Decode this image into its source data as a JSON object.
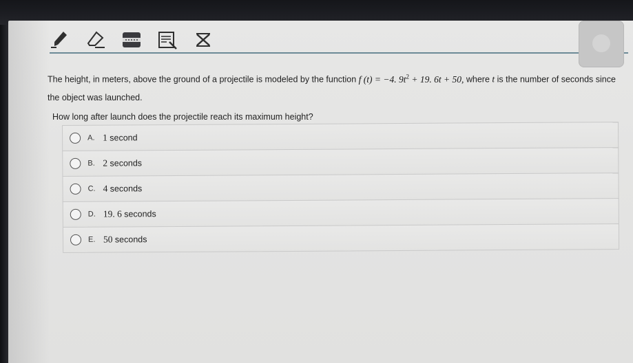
{
  "toolbar": {
    "tools": [
      {
        "name": "pencil-icon"
      },
      {
        "name": "eraser-icon"
      },
      {
        "name": "highlight-bar-icon"
      },
      {
        "name": "notes-icon"
      },
      {
        "name": "crossout-icon"
      }
    ]
  },
  "question": {
    "text_before": "The height, in meters, above the ground of a projectile is modeled by the function ",
    "function_lhs": "f (t) = −4. 9t",
    "exponent": "2",
    "function_rhs": " + 19. 6t + 50,",
    "text_where": " where ",
    "variable": "t",
    "text_after": " is the number of seconds since the object was launched."
  },
  "prompt": "How long after launch does the projectile reach its maximum height?",
  "options": [
    {
      "letter": "A.",
      "value": "1",
      "unit": "second"
    },
    {
      "letter": "B.",
      "value": "2",
      "unit": "seconds"
    },
    {
      "letter": "C.",
      "value": "4",
      "unit": "seconds"
    },
    {
      "letter": "D.",
      "value": "19. 6",
      "unit": "seconds"
    },
    {
      "letter": "E.",
      "value": "50",
      "unit": "seconds"
    }
  ],
  "colors": {
    "rule": "#6b8a96",
    "page": "#e5e5e4",
    "text": "#222222"
  }
}
